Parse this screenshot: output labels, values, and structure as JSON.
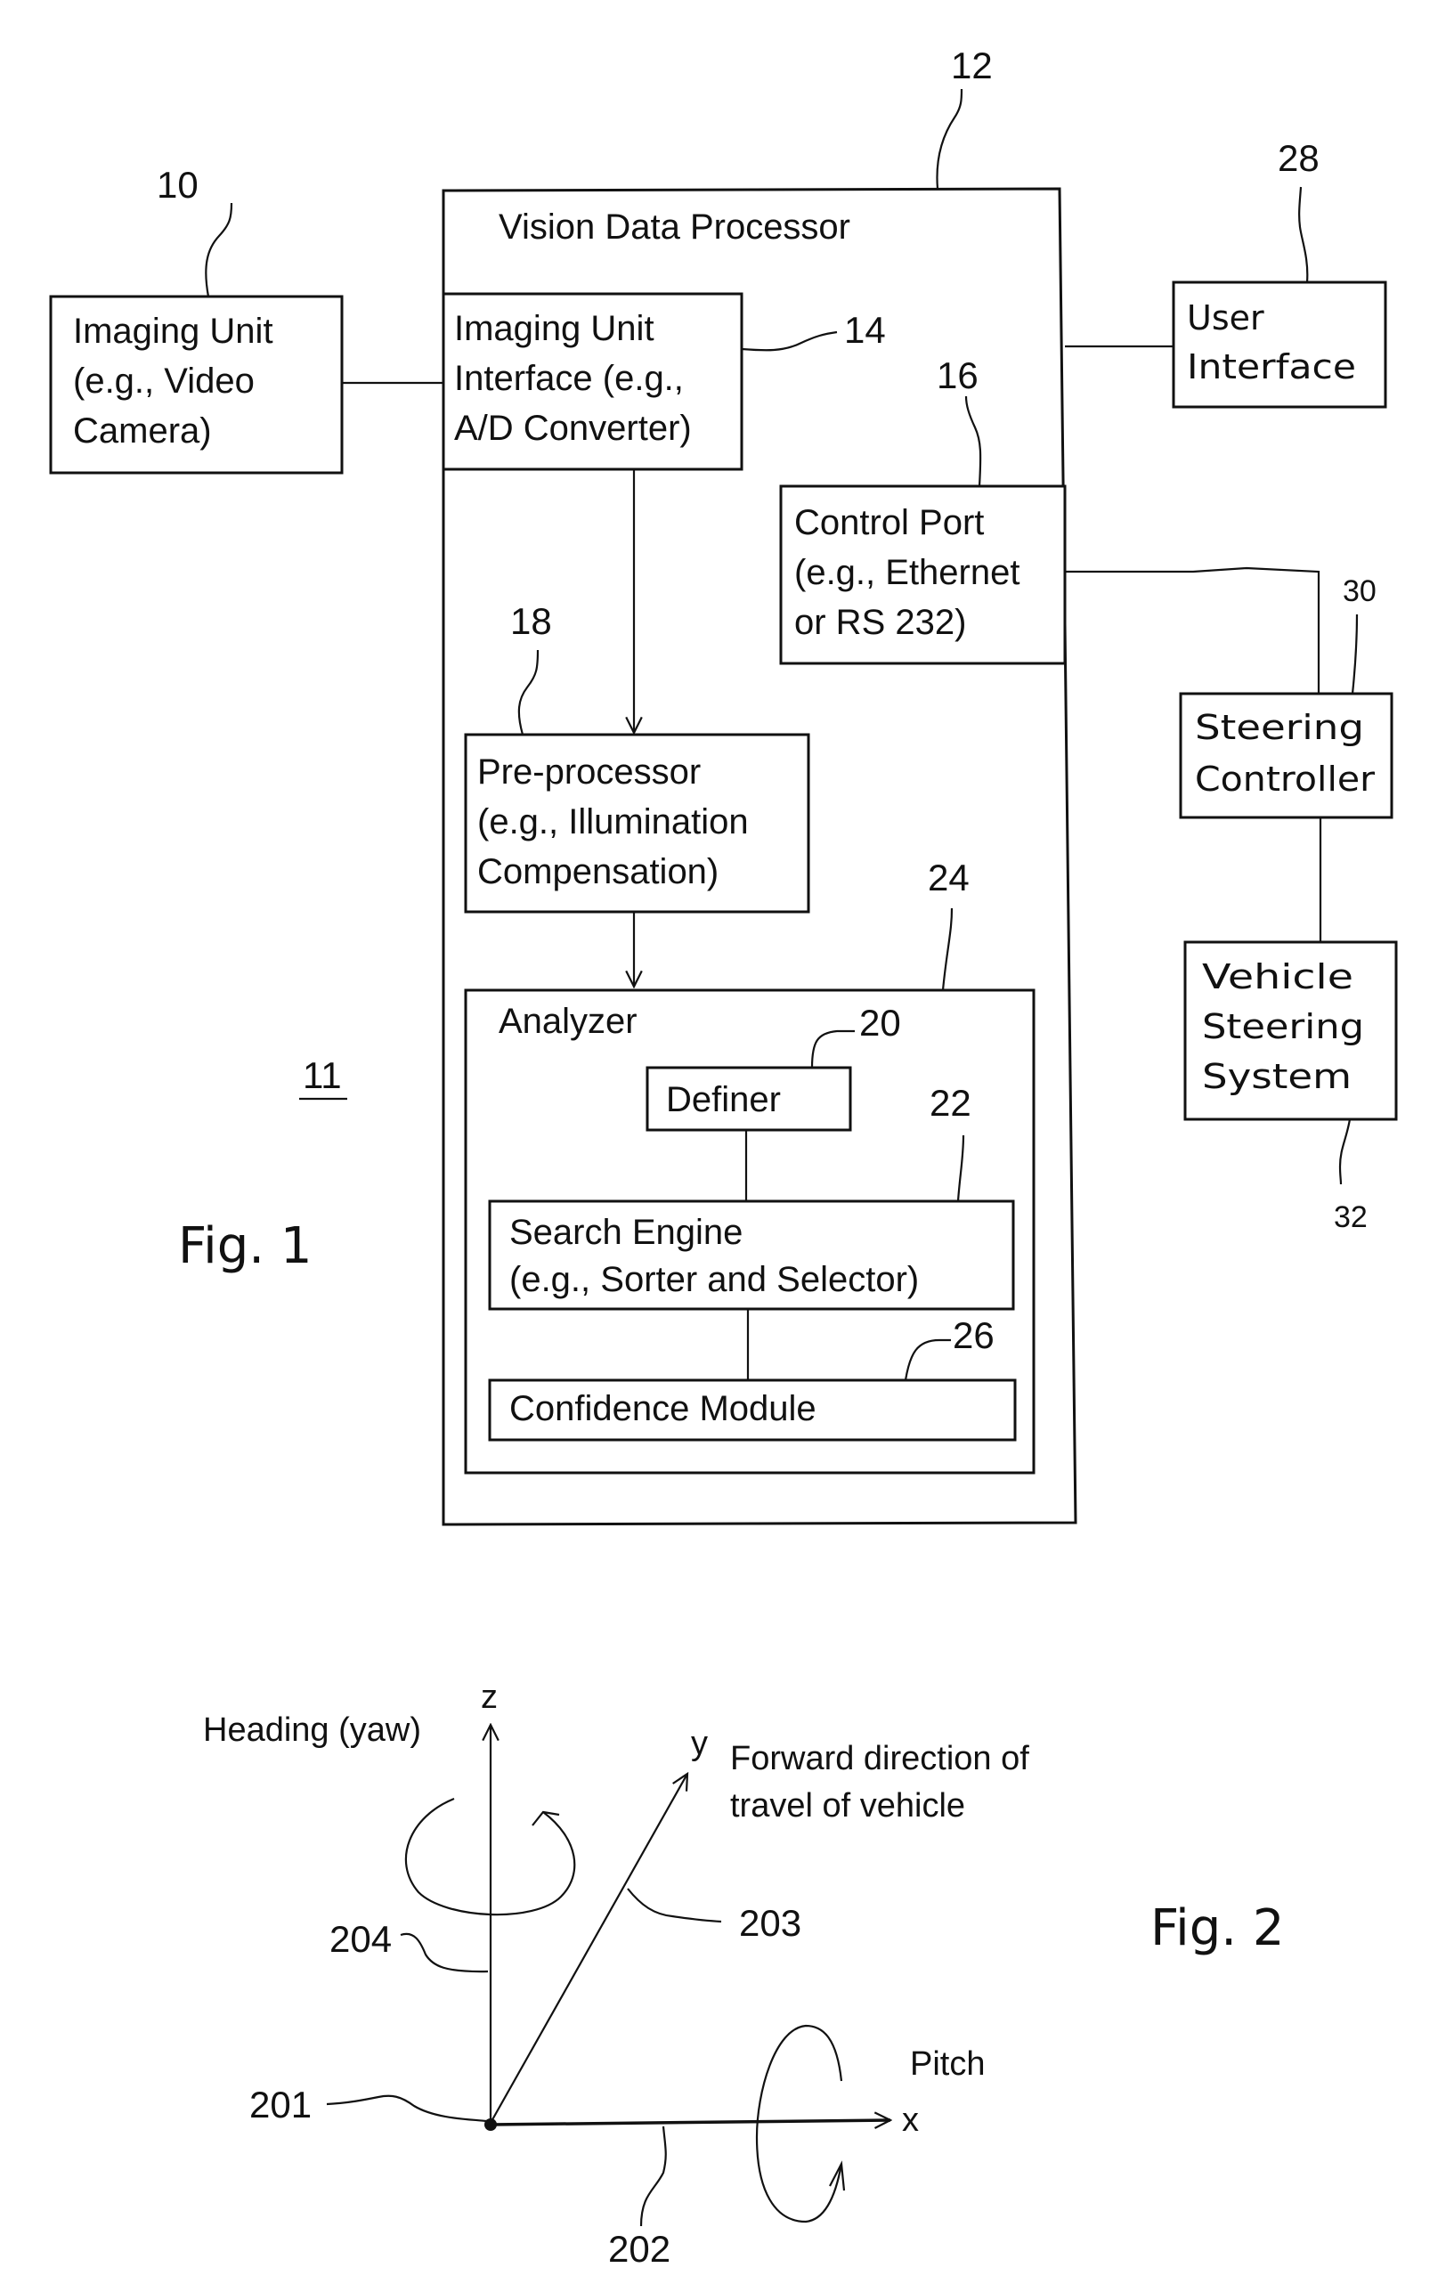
{
  "fig1": {
    "caption": "Fig. 1",
    "system_ref": "11",
    "imaging_unit": {
      "ref": "10",
      "lines": [
        "Imaging Unit",
        "(e.g., Video",
        "Camera)"
      ]
    },
    "vision_data_processor": {
      "ref": "12",
      "title": "Vision Data Processor"
    },
    "imaging_unit_interface": {
      "ref": "14",
      "lines": [
        "Imaging Unit",
        "Interface (e.g.,",
        "A/D Converter)"
      ]
    },
    "control_port": {
      "ref": "16",
      "lines": [
        "Control Port",
        "(e.g., Ethernet",
        "or RS 232)"
      ]
    },
    "pre_processor": {
      "ref": "18",
      "lines": [
        "Pre-processor",
        "(e.g., Illumination",
        "Compensation)"
      ]
    },
    "analyzer": {
      "ref": "24",
      "title": "Analyzer"
    },
    "definer": {
      "ref": "20",
      "label": "Definer"
    },
    "search_engine": {
      "ref": "22",
      "lines": [
        "Search Engine",
        "(e.g., Sorter and Selector)"
      ]
    },
    "confidence_module": {
      "ref": "26",
      "label": "Confidence Module"
    },
    "user_interface": {
      "ref": "28",
      "lines": [
        "User",
        "Interface"
      ]
    },
    "steering_controller": {
      "ref": "30",
      "lines": [
        "Steering",
        "Controller"
      ]
    },
    "vehicle_steering_system": {
      "ref": "32",
      "lines": [
        "Vehicle",
        "Steering",
        "System"
      ]
    }
  },
  "fig2": {
    "caption": "Fig. 2",
    "z_label": "z",
    "y_label": "y",
    "x_label": "x",
    "heading_label": "Heading (yaw)",
    "forward_lines": [
      "Forward direction of",
      "travel of vehicle"
    ],
    "pitch_label": "Pitch",
    "refs": {
      "origin": "201",
      "x_axis": "202",
      "y_axis": "203",
      "z_axis": "204"
    }
  }
}
